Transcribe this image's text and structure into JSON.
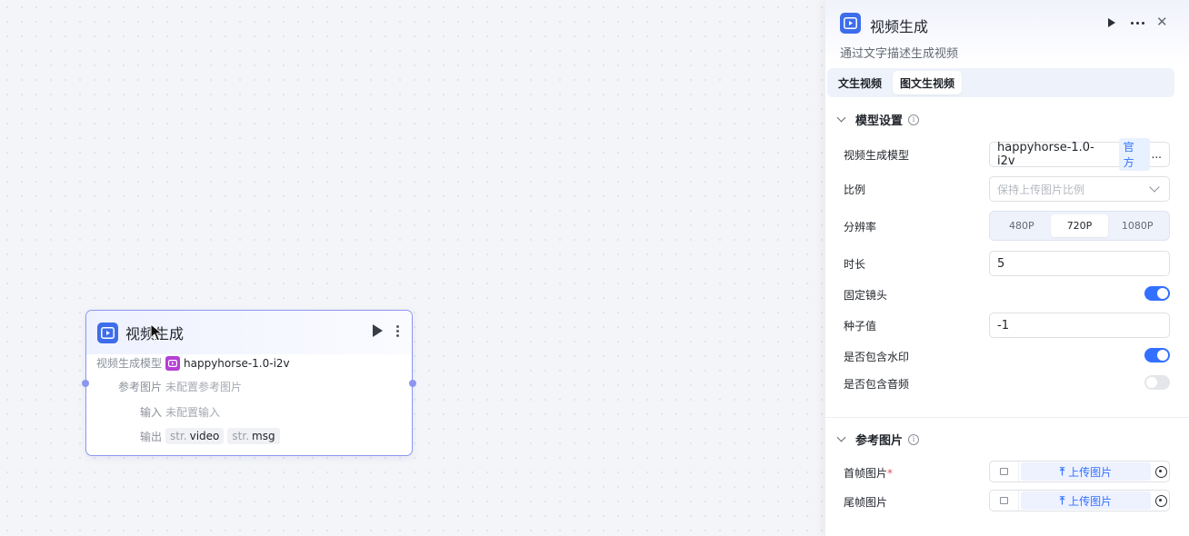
{
  "node": {
    "title": "视频生成",
    "rows": {
      "model_label": "视频生成模型",
      "model_value": "happyhorse-1.0-i2v",
      "ref_label": "参考图片",
      "ref_value": "未配置参考图片",
      "input_label": "输入",
      "input_value": "未配置输入",
      "output_label": "输出",
      "outputs": [
        {
          "type": "str.",
          "name": "video"
        },
        {
          "type": "str.",
          "name": "msg"
        }
      ]
    }
  },
  "panel": {
    "title": "视频生成",
    "description": "通过文字描述生成视频",
    "tabs": [
      "文生视频",
      "图文生视频"
    ],
    "active_tab": "图文生视频",
    "model_section": {
      "title": "模型设置",
      "info_icon": "info-icon",
      "model_label": "视频生成模型",
      "model_value": "happyhorse-1.0-i2v",
      "model_badge": "官方",
      "model_ellipsis": "...",
      "ratio_label": "比例",
      "ratio_placeholder": "保持上传图片比例",
      "resolution_label": "分辨率",
      "resolution_options": [
        "480P",
        "720P",
        "1080P"
      ],
      "resolution_selected": "720P",
      "duration_label": "时长",
      "duration_value": "5",
      "fixed_lens_label": "固定镜头",
      "fixed_lens_on": true,
      "seed_label": "种子值",
      "seed_value": "-1",
      "watermark_label": "是否包含水印",
      "watermark_on": true,
      "audio_label": "是否包含音频",
      "audio_on": false
    },
    "ref_section": {
      "title": "参考图片",
      "first_frame_label": "首帧图片",
      "required_mark": "*",
      "last_frame_label": "尾帧图片",
      "upload_label": "上传图片"
    }
  },
  "colors": {
    "accent": "#3370ff",
    "node_icon": "#3d6dea",
    "model_badge_bg": "#b53fd6",
    "node_border": "#8c96f0"
  }
}
